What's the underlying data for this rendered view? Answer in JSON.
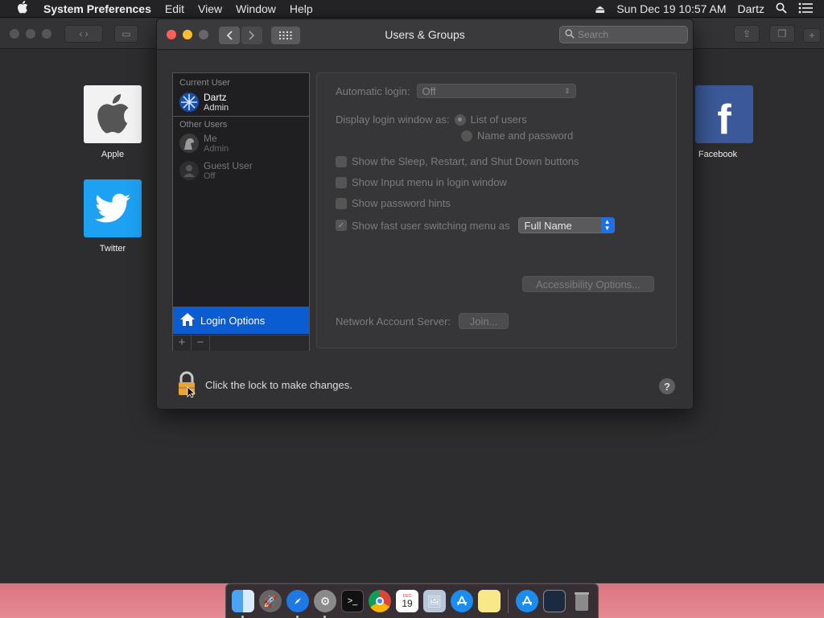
{
  "menubar": {
    "app": "System Preferences",
    "items": [
      "Edit",
      "View",
      "Window",
      "Help"
    ],
    "datetime": "Sun Dec 19  10:57 AM",
    "user": "Dartz"
  },
  "desktop_tiles": [
    {
      "label": "Apple",
      "icon": "apple-icon"
    },
    {
      "label": "Twitter",
      "icon": "twitter-icon"
    },
    {
      "label": "Facebook",
      "icon": "facebook-icon"
    }
  ],
  "window": {
    "title": "Users & Groups",
    "search_placeholder": "Search"
  },
  "users": {
    "current_header": "Current User",
    "current": {
      "name": "Dartz",
      "role": "Admin"
    },
    "other_header": "Other Users",
    "others": [
      {
        "name": "Me",
        "role": "Admin"
      },
      {
        "name": "Guest User",
        "role": "Off"
      }
    ],
    "login_options": "Login Options"
  },
  "settings": {
    "auto_login_label": "Automatic login:",
    "auto_login_value": "Off",
    "display_label": "Display login window as:",
    "display_options": [
      "List of users",
      "Name and password"
    ],
    "checkboxes": [
      "Show the Sleep, Restart, and Shut Down buttons",
      "Show Input menu in login window",
      "Show password hints",
      "Show fast user switching menu as"
    ],
    "fast_switch_value": "Full Name",
    "accessibility_button": "Accessibility Options...",
    "network_label": "Network Account Server:",
    "join_button": "Join..."
  },
  "bottom": {
    "lock_text": "Click the lock to make changes.",
    "help": "?"
  },
  "colors": {
    "accent": "#0b5bd1",
    "close": "#ff5f57",
    "minimize": "#febc2e"
  }
}
